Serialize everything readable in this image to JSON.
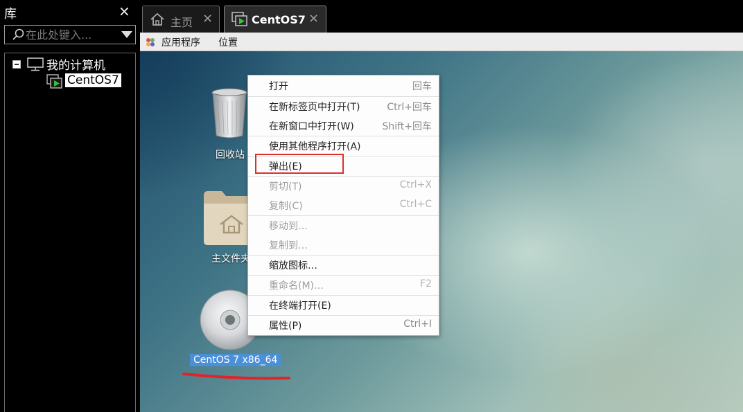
{
  "library": {
    "title": "库",
    "close": "×",
    "search_placeholder": "在此处键入...",
    "tree": {
      "root_label": "我的计算机",
      "vm_label": "CentOS7"
    }
  },
  "tabs": [
    {
      "label": "主页",
      "icon": "home-icon",
      "close": "×"
    },
    {
      "label": "CentOS7",
      "icon": "vm-icon",
      "close": "×",
      "active": true
    }
  ],
  "guest_menubar": {
    "items": [
      "应用程序",
      "位置"
    ]
  },
  "desktop": {
    "icons": [
      {
        "label": "回收站",
        "icon": "trash-icon"
      },
      {
        "label": "主文件夹",
        "icon": "home-folder-icon"
      },
      {
        "label": "CentOS 7 x86_64",
        "icon": "dvd-icon",
        "selected": true
      }
    ]
  },
  "context_menu": {
    "items": [
      {
        "label": "打开",
        "shortcut": "回车",
        "enabled": true
      },
      {
        "label": "在新标签页中打开(T)",
        "shortcut": "Ctrl+回车",
        "enabled": true
      },
      {
        "label": "在新窗口中打开(W)",
        "shortcut": "Shift+回车",
        "enabled": true
      },
      {
        "label": "使用其他程序打开(A)",
        "shortcut": "",
        "enabled": true
      },
      {
        "label": "弹出(E)",
        "shortcut": "",
        "enabled": true,
        "highlighted": true
      },
      {
        "label": "剪切(T)",
        "shortcut": "Ctrl+X",
        "enabled": false
      },
      {
        "label": "复制(C)",
        "shortcut": "Ctrl+C",
        "enabled": false
      },
      {
        "label": "移动到…",
        "shortcut": "",
        "enabled": false
      },
      {
        "label": "复制到…",
        "shortcut": "",
        "enabled": false
      },
      {
        "label": "缩放图标…",
        "shortcut": "",
        "enabled": true
      },
      {
        "label": "重命名(M)…",
        "shortcut": "F2",
        "enabled": false
      },
      {
        "label": "在终端打开(E)",
        "shortcut": "",
        "enabled": true
      },
      {
        "label": "属性(P)",
        "shortcut": "Ctrl+I",
        "enabled": true
      }
    ]
  },
  "colors": {
    "highlight_box": "#d9302c",
    "selection": "#4a90d9",
    "annotation_underline": "#e0242a"
  }
}
